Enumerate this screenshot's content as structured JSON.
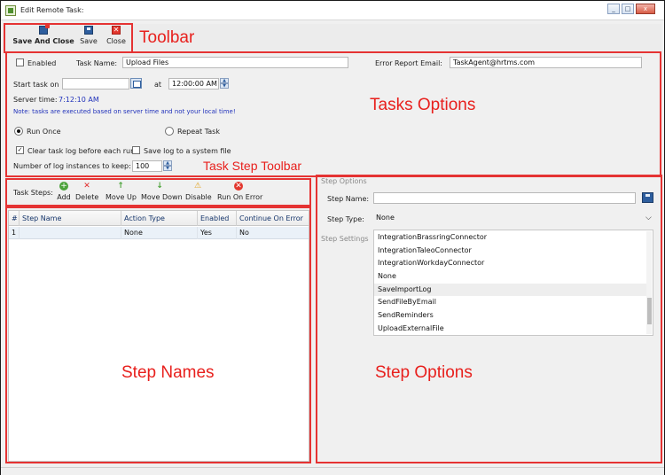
{
  "window": {
    "title": "Edit Remote Task:",
    "controls": {
      "minimize": "_",
      "maximize": "□",
      "close": "x"
    }
  },
  "toolbar": {
    "save_and_close": "Save And Close",
    "save": "Save",
    "close": "Close"
  },
  "task_options": {
    "enabled_label": "Enabled",
    "enabled_checked": false,
    "task_name_label": "Task Name:",
    "task_name_value": "Upload Files",
    "error_email_label": "Error Report Email:",
    "error_email_value": "TaskAgent@hrtms.com",
    "start_task_label": "Start task on",
    "start_date_value": "",
    "at_label": "at",
    "start_time_value": "12:00:00 AM",
    "server_time_label": "Server time:",
    "server_time_value": "7:12:10 AM",
    "note": "Note: tasks are executed based on server time and not your local time!",
    "run_once_label": "Run Once",
    "repeat_task_label": "Repeat Task",
    "clear_log_label": "Clear task log before each run",
    "clear_log_checked": true,
    "save_log_label": "Save log to a system file",
    "save_log_checked": false,
    "log_instances_label": "Number of log instances to keep:",
    "log_instances_value": "100"
  },
  "step_toolbar": {
    "label": "Task Steps:",
    "add": "Add",
    "delete": "Delete",
    "move_up": "Move Up",
    "move_down": "Move Down",
    "disable": "Disable",
    "run_on_error": "Run On Error"
  },
  "steps_grid": {
    "columns": [
      "#",
      "Step Name",
      "Action Type",
      "Enabled",
      "Continue On Error"
    ],
    "rows": [
      {
        "num": "1",
        "name": "",
        "action_type": "None",
        "enabled": "Yes",
        "continue_on_error": "No"
      }
    ]
  },
  "step_options": {
    "group_label": "Step Options",
    "step_name_label": "Step Name:",
    "step_name_value": "",
    "step_type_label": "Step Type:",
    "step_type_value": "None",
    "settings_label": "Step Settings",
    "type_options": [
      "IntegrationBrassringConnector",
      "IntegrationTaleoConnector",
      "IntegrationWorkdayConnector",
      "None",
      "SaveImportLog",
      "SendFileByEmail",
      "SendReminders",
      "UploadExternalFile"
    ],
    "highlighted_option": "SaveImportLog"
  },
  "annotations": {
    "toolbar": "Toolbar",
    "tasks_options": "Tasks Options",
    "task_step_toolbar": "Task Step Toolbar",
    "step_names": "Step Names",
    "step_options": "Step Options"
  },
  "colors": {
    "annotation": "#e53333",
    "note_text": "#2233bb",
    "selected_row": "#eaf1f8"
  }
}
